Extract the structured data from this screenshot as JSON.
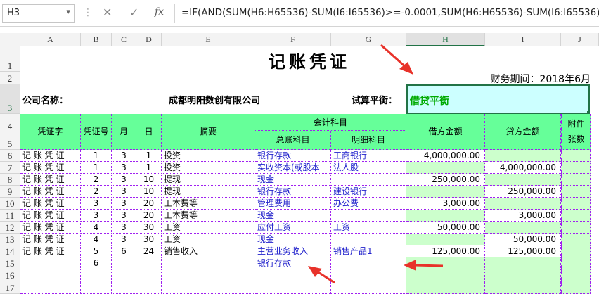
{
  "formula_bar": {
    "name_box": "H3",
    "cancel_glyph": "✕",
    "enter_glyph": "✓",
    "fx_label": "fx",
    "formula": "=IF(AND(SUM(H6:H65536)-SUM(I6:I65536)>=-0.0001,SUM(H6:H65536)-SUM(I6:I65536)<=0"
  },
  "columns": [
    "A",
    "B",
    "C",
    "D",
    "E",
    "F",
    "G",
    "H",
    "I",
    "J"
  ],
  "rows": [
    "1",
    "2",
    "3",
    "4",
    "5",
    "6",
    "7",
    "8",
    "9",
    "10",
    "11",
    "12",
    "13",
    "14",
    "15",
    "16",
    "17"
  ],
  "sheet": {
    "title": "记账凭证",
    "period": "财务期间：2018年6月",
    "company_label": "公司名称：",
    "company_name": "成都明阳数创有限公司",
    "balance_label": "试算平衡：",
    "balance_value": "借贷平衡"
  },
  "headers": {
    "voucher_type": "凭证字",
    "voucher_no": "凭证号",
    "month": "月",
    "day": "日",
    "summary": "摘要",
    "accounts": "会计科目",
    "general_account": "总账科目",
    "detail_account": "明细科目",
    "debit": "借方金额",
    "credit": "贷方金额",
    "attachments_1": "附件",
    "attachments_2": "张数"
  },
  "entries": [
    {
      "type": "记 账 凭 证",
      "no": "1",
      "month": "3",
      "day": "1",
      "summary": "投资",
      "general": "银行存款",
      "detail": "工商银行",
      "debit": "4,000,000.00",
      "credit": ""
    },
    {
      "type": "记 账 凭 证",
      "no": "1",
      "month": "3",
      "day": "1",
      "summary": "投资",
      "general": "实收资本(或股本",
      "detail": "法人股",
      "debit": "",
      "credit": "4,000,000.00"
    },
    {
      "type": "记 账 凭 证",
      "no": "2",
      "month": "3",
      "day": "10",
      "summary": "提现",
      "general": "现金",
      "detail": "",
      "debit": "250,000.00",
      "credit": ""
    },
    {
      "type": "记 账 凭 证",
      "no": "2",
      "month": "3",
      "day": "10",
      "summary": "提现",
      "general": "银行存款",
      "detail": "建设银行",
      "debit": "",
      "credit": "250,000.00"
    },
    {
      "type": "记 账 凭 证",
      "no": "3",
      "month": "3",
      "day": "20",
      "summary": "工本费等",
      "general": "管理费用",
      "detail": "办公费",
      "debit": "3,000.00",
      "credit": ""
    },
    {
      "type": "记 账 凭 证",
      "no": "3",
      "month": "3",
      "day": "20",
      "summary": "工本费等",
      "general": "现金",
      "detail": "",
      "debit": "",
      "credit": "3,000.00"
    },
    {
      "type": "记 账 凭 证",
      "no": "4",
      "month": "3",
      "day": "30",
      "summary": "工资",
      "general": "应付工资",
      "detail": "工资",
      "debit": "50,000.00",
      "credit": ""
    },
    {
      "type": "记 账 凭 证",
      "no": "4",
      "month": "3",
      "day": "30",
      "summary": "工资",
      "general": "现金",
      "detail": "",
      "debit": "",
      "credit": "50,000.00"
    },
    {
      "type": "记 账 凭 证",
      "no": "5",
      "month": "6",
      "day": "24",
      "summary": "销售收入",
      "general": "主营业务收入",
      "detail": "销售产品1",
      "debit": "125,000.00",
      "credit": "125,000.00"
    },
    {
      "type": "",
      "no": "6",
      "month": "",
      "day": "",
      "summary": "",
      "general": "银行存款",
      "detail": "",
      "debit": "",
      "credit": ""
    },
    {
      "type": "",
      "no": "",
      "month": "",
      "day": "",
      "summary": "",
      "general": "",
      "detail": "",
      "debit": "",
      "credit": ""
    },
    {
      "type": "",
      "no": "",
      "month": "",
      "day": "",
      "summary": "",
      "general": "",
      "detail": "",
      "debit": "",
      "credit": ""
    }
  ],
  "colors": {
    "header_green": "#66ff99",
    "cell_green": "#ccffcc",
    "balance_bg": "#ccffff",
    "balance_text": "#00aa00",
    "account_text": "#2222cc",
    "dotted_border": "#a020f0",
    "arrow_red": "#e8322a"
  },
  "icons": {
    "name_box_dropdown": "chevron-down-icon",
    "cancel": "close-icon",
    "enter": "check-icon",
    "function": "fx-icon"
  }
}
